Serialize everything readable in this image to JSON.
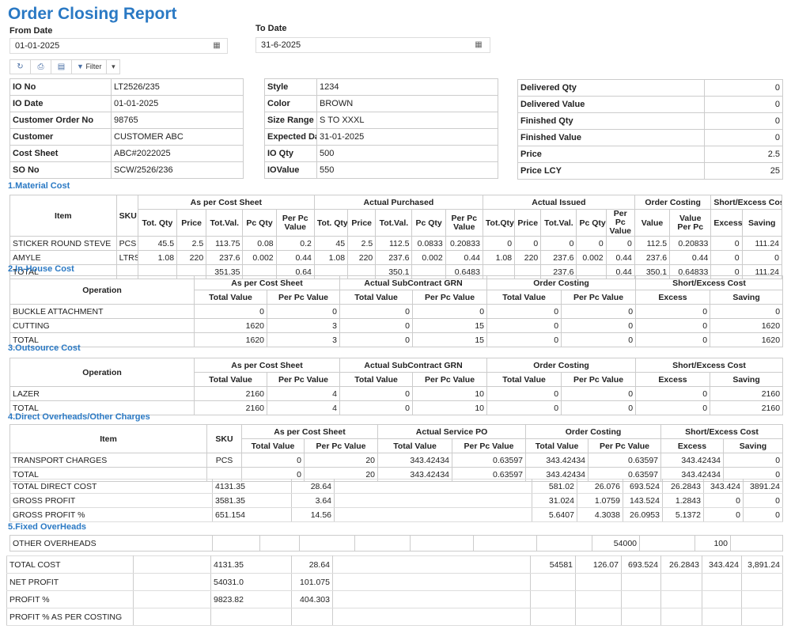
{
  "title": "Order Closing Report",
  "from_date": {
    "label": "From Date",
    "value": "01-01-2025"
  },
  "to_date": {
    "label": "To Date",
    "value": "31-6-2025"
  },
  "toolbar": {
    "filter_label": "Filter"
  },
  "info_left": [
    [
      "IO No",
      "LT2526/235"
    ],
    [
      "IO Date",
      "01-01-2025"
    ],
    [
      "Customer Order No",
      "98765"
    ],
    [
      "Customer",
      "CUSTOMER ABC"
    ],
    [
      "Cost Sheet",
      "ABC#2022025"
    ],
    [
      "SO No",
      "SCW/2526/236"
    ]
  ],
  "info_mid": [
    [
      "Style",
      "1234"
    ],
    [
      "Color",
      "BROWN"
    ],
    [
      "Size Range",
      "S TO XXXL"
    ],
    [
      "Expected Date",
      "31-01-2025"
    ],
    [
      "IO Qty",
      "500"
    ],
    [
      "IOValue",
      "550"
    ]
  ],
  "info_right": [
    [
      "Delivered Qty",
      "0"
    ],
    [
      "Delivered Value",
      "0"
    ],
    [
      "Finished Qty",
      "0"
    ],
    [
      "Finished Value",
      "0"
    ],
    [
      "Price",
      "2.5"
    ],
    [
      "Price LCY",
      "25"
    ]
  ],
  "material": {
    "section": "1.Material Cost",
    "h": {
      "item": "Item",
      "sku": "SKU",
      "g1": "As per Cost Sheet",
      "g2": "Actual Purchased",
      "g3": "Actual Issued",
      "g4": "Order Costing",
      "g5": "Short/Excess Cost",
      "totqty": "Tot. Qty",
      "price": "Price",
      "totval": "Tot.Val.",
      "pcqty": "Pc Qty",
      "perpc": "Per Pc Value",
      "totqty3": "Tot.Qty",
      "value": "Value",
      "vpp": "Value Per Pc",
      "excess": "Excess",
      "saving": "Saving"
    },
    "rows": [
      [
        "STICKER ROUND STEVE",
        "PCS",
        "45.5",
        "2.5",
        "113.75",
        "0.08",
        "0.2",
        "45",
        "2.5",
        "112.5",
        "0.0833",
        "0.20833",
        "0",
        "0",
        "0",
        "0",
        "0",
        "112.5",
        "0.20833",
        "0",
        "111.24"
      ],
      [
        "AMYLE",
        "LTRS",
        "1.08",
        "220",
        "237.6",
        "0.002",
        "0.44",
        "1.08",
        "220",
        "237.6",
        "0.002",
        "0.44",
        "1.08",
        "220",
        "237.6",
        "0.002",
        "0.44",
        "237.6",
        "0.44",
        "0",
        "0"
      ],
      [
        "TOTAL",
        "",
        "",
        "",
        "351.35",
        "",
        "0.64",
        "",
        "",
        "350.1",
        "",
        "0.6483",
        "",
        "",
        "237.6",
        "",
        "0.44",
        "350.1",
        "0.64833",
        "0",
        "111.24"
      ]
    ]
  },
  "inhouse": {
    "section": "2.In-House Cost",
    "h": {
      "op": "Operation",
      "g1": "As per Cost Sheet",
      "g2": "Actual SubContract GRN",
      "g3": "Order Costing",
      "g4": "Short/Excess Cost",
      "tv": "Total Value",
      "ppv": "Per Pc Value",
      "excess": "Excess",
      "saving": "Saving"
    },
    "rows": [
      [
        "BUCKLE ATTACHMENT",
        "0",
        "0",
        "0",
        "0",
        "0",
        "0",
        "0",
        "0"
      ],
      [
        "CUTTING",
        "1620",
        "3",
        "0",
        "15",
        "0",
        "0",
        "0",
        "1620"
      ],
      [
        "TOTAL",
        "1620",
        "3",
        "0",
        "15",
        "0",
        "0",
        "0",
        "1620"
      ]
    ]
  },
  "outsource": {
    "section": "3.Outsource Cost",
    "h": {
      "op": "Operation",
      "g1": "As per Cost Sheet",
      "g2": "Actual SubContract GRN",
      "g3": "Order Costing",
      "g4": "Short/Excess Cost",
      "tv": "Total Value",
      "ppv": "Per Pc Value",
      "excess": "Excess",
      "saving": "Saving"
    },
    "rows": [
      [
        "LAZER",
        "2160",
        "4",
        "0",
        "10",
        "0",
        "0",
        "0",
        "2160"
      ],
      [
        "TOTAL",
        "2160",
        "4",
        "0",
        "10",
        "0",
        "0",
        "0",
        "2160"
      ]
    ]
  },
  "overheads": {
    "section": "4.Direct Overheads/Other Charges",
    "h": {
      "item": "Item",
      "sku": "SKU",
      "g1": "As per Cost Sheet",
      "g2": "Actual Service PO",
      "g3": "Order Costing",
      "g4": "Short/Excess Cost",
      "tv": "Total Value",
      "ppv": "Per Pc Value",
      "excess": "Excess",
      "saving": "Saving"
    },
    "rows": [
      [
        "TRANSPORT CHARGES",
        "PCS",
        "0",
        "20",
        "343.42434",
        "0.63597",
        "343.42434",
        "0.63597",
        "343.42434",
        "0"
      ],
      [
        "TOTAL",
        "",
        "0",
        "20",
        "343.42434",
        "0.63597",
        "343.42434",
        "0.63597",
        "343.42434",
        "0"
      ]
    ]
  },
  "summary1": [
    [
      "TOTAL DIRECT COST",
      "4131.35",
      "28.64",
      "581.02",
      "26.076",
      "693.524",
      "26.2843",
      "343.424",
      "3891.24"
    ],
    [
      "GROSS PROFIT",
      "3581.35",
      "3.64",
      "31.024",
      "1.0759",
      "143.524",
      "1.2843",
      "0",
      "0"
    ],
    [
      "GROSS PROFIT %",
      "651.154",
      "14.56",
      "5.6407",
      "4.3038",
      "26.0953",
      "5.1372",
      "0",
      "0"
    ]
  ],
  "fixed": {
    "section": "5.Fixed OverHeads",
    "label": "OTHER OVERHEADS",
    "v1": "54000",
    "v2": "100"
  },
  "summary2": [
    [
      "TOTAL COST",
      "4131.35",
      "28.64",
      "54581",
      "126.07",
      "693.524",
      "26.2843",
      "343.424",
      "3,891.24"
    ],
    [
      "NET PROFIT",
      "54031.0",
      "101.075",
      "",
      "",
      "",
      "",
      "",
      ""
    ],
    [
      "PROFIT %",
      "9823.82",
      "404.303",
      "",
      "",
      "",
      "",
      "",
      ""
    ],
    [
      "PROFIT % AS PER COSTING",
      "",
      "",
      "",
      "",
      "",
      "",
      "",
      ""
    ]
  ]
}
